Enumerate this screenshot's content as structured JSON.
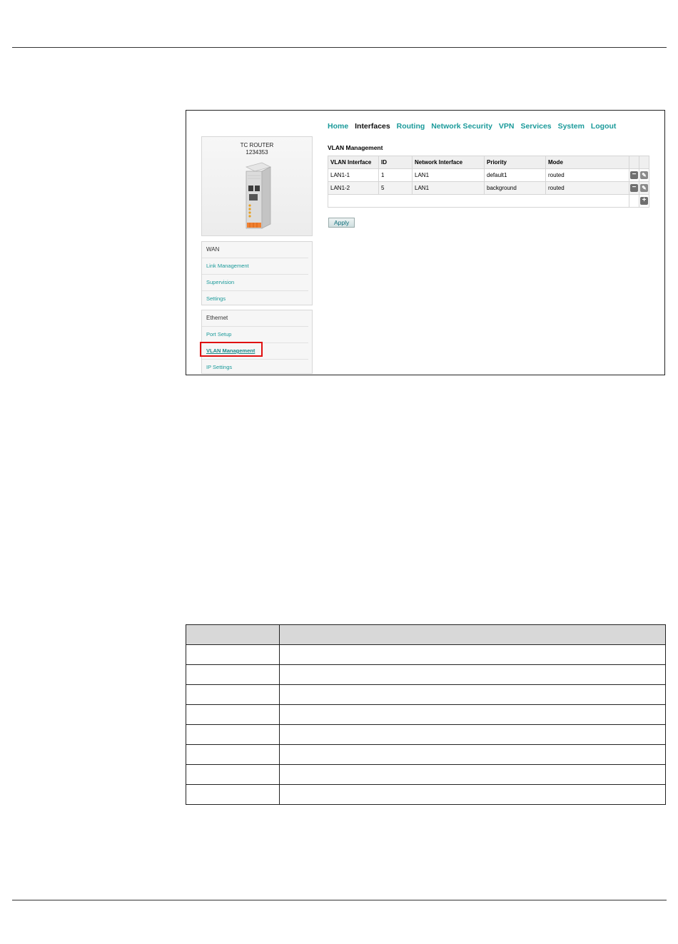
{
  "device": {
    "name": "TC ROUTER",
    "serial": "1234353"
  },
  "nav": {
    "items": [
      {
        "label": "Home",
        "active": false
      },
      {
        "label": "Interfaces",
        "active": true
      },
      {
        "label": "Routing",
        "active": false
      },
      {
        "label": "Network Security",
        "active": false
      },
      {
        "label": "VPN",
        "active": false
      },
      {
        "label": "Services",
        "active": false
      },
      {
        "label": "System",
        "active": false
      },
      {
        "label": "Logout",
        "active": false
      }
    ]
  },
  "sidebar": {
    "wan": {
      "title": "WAN",
      "links": [
        "Link Management",
        "Supervision",
        "Settings"
      ]
    },
    "ethernet": {
      "title": "Ethernet",
      "links": [
        "Port Setup",
        "VLAN Management",
        "IP Settings"
      ]
    }
  },
  "main": {
    "section_title": "VLAN Management",
    "table": {
      "headers": [
        "VLAN Interface",
        "ID",
        "Network Interface",
        "Priority",
        "Mode"
      ],
      "rows": [
        [
          "LAN1-1",
          "1",
          "LAN1",
          "default1",
          "routed"
        ],
        [
          "LAN1-2",
          "5",
          "LAN1",
          "background",
          "routed"
        ]
      ]
    },
    "apply_label": "Apply"
  },
  "colors": {
    "accent": "#1a9a9a",
    "highlight": "#e01010"
  },
  "icons": {
    "delete": "minus-icon",
    "edit": "edit-icon",
    "add": "plus-icon"
  }
}
